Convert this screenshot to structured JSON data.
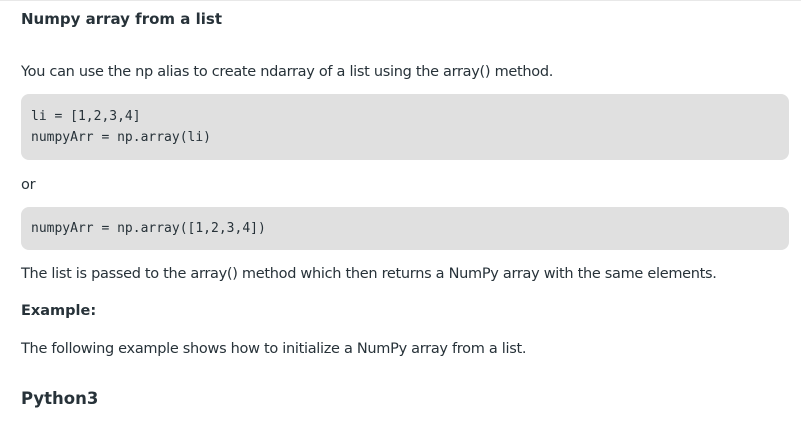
{
  "section_title": "Numpy array from a list",
  "intro_text": "You can use the np alias to create ndarray of a list using the array() method.",
  "code_block_1": {
    "lines": [
      "li = [1,2,3,4]",
      "numpyArr = np.array(li)"
    ]
  },
  "or_text": "or",
  "code_block_2": {
    "lines": [
      "numpyArr = np.array([1,2,3,4])"
    ]
  },
  "explanation_text": "The list is passed to the array() method which then returns a NumPy array with the same elements.",
  "example_heading": "Example:",
  "example_text": "The following example shows how to initialize a NumPy array from a list.",
  "language_heading": "Python3",
  "colors": {
    "text": "#273239",
    "code_background": "#e0e0e0"
  }
}
